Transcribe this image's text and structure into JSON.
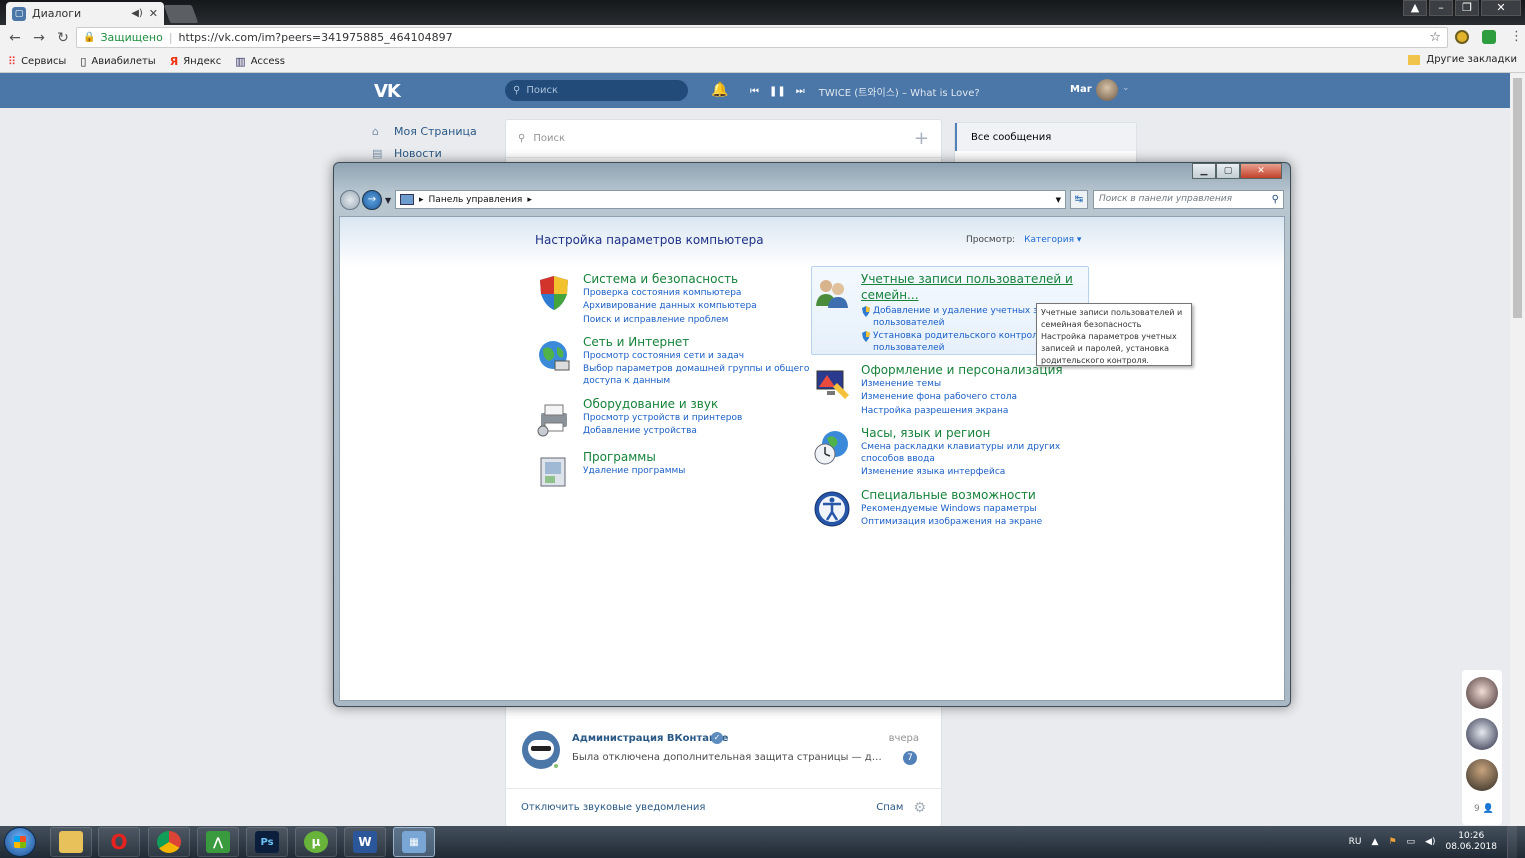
{
  "browser": {
    "tab_title": "Диалоги",
    "url_secure_label": "Защищено",
    "url": "https://vk.com/im?peers=341975885_464104897",
    "bookmarks": [
      "Сервисы",
      "Авиабилеты",
      "Яндекс",
      "Access"
    ],
    "other_bookmarks": "Другие закладки"
  },
  "vk": {
    "search_placeholder": "Поиск",
    "now_playing": "TWICE (트와이스) – What is Love?",
    "user_name": "Mar",
    "left_menu": [
      "Моя Страница",
      "Новости"
    ],
    "dialogs_search_placeholder": "Поиск",
    "right_menu_selected": "Все сообщения",
    "dialog": {
      "name": "Администрация ВКонтакте",
      "time": "вчера",
      "text": "Была отключена дополнительная защита страницы — двухф...",
      "unread": "7"
    },
    "footer_mute": "Отключить звуковые уведомления",
    "footer_spam": "Спам",
    "side_count": "9"
  },
  "control_panel": {
    "breadcrumb": "Панель управления",
    "search_placeholder": "Поиск в панели управления",
    "heading": "Настройка параметров компьютера",
    "view_label": "Просмотр:",
    "view_value": "Категория",
    "categories_left": [
      {
        "title": "Система и безопасность",
        "links": [
          "Проверка состояния компьютера",
          "Архивирование данных компьютера",
          "Поиск и исправление проблем"
        ]
      },
      {
        "title": "Сеть и Интернет",
        "links": [
          "Просмотр состояния сети и задач",
          "Выбор параметров домашней группы и общего",
          "доступа к данным"
        ]
      },
      {
        "title": "Оборудование и звук",
        "links": [
          "Просмотр устройств и принтеров",
          "Добавление устройства"
        ]
      },
      {
        "title": "Программы",
        "links": [
          "Удаление программы"
        ]
      }
    ],
    "categories_right": [
      {
        "title_line1": "Учетные записи пользователей и",
        "title_line2": "семейн...",
        "links": [
          "Добавление и удаление учетных зап",
          "пользователей",
          "Установка родительского контроля",
          "пользователей"
        ]
      },
      {
        "title": "Оформление и персонализация",
        "links": [
          "Изменение темы",
          "Изменение фона рабочего стола",
          "Настройка разрешения экрана"
        ]
      },
      {
        "title": "Часы, язык и регион",
        "links": [
          "Смена раскладки клавиатуры или других",
          "способов ввода",
          "Изменение языка интерфейса"
        ]
      },
      {
        "title": "Специальные возможности",
        "links": [
          "Рекомендуемые Windows параметры",
          "Оптимизация изображения на экране"
        ]
      }
    ],
    "tooltip": [
      "Учетные записи пользователей и",
      "семейная безопасность",
      "Настройка параметров учетных",
      "записей и паролей, установка",
      "родительского контроля."
    ]
  },
  "taskbar": {
    "lang": "RU",
    "time": "10:26",
    "date": "08.06.2018"
  }
}
